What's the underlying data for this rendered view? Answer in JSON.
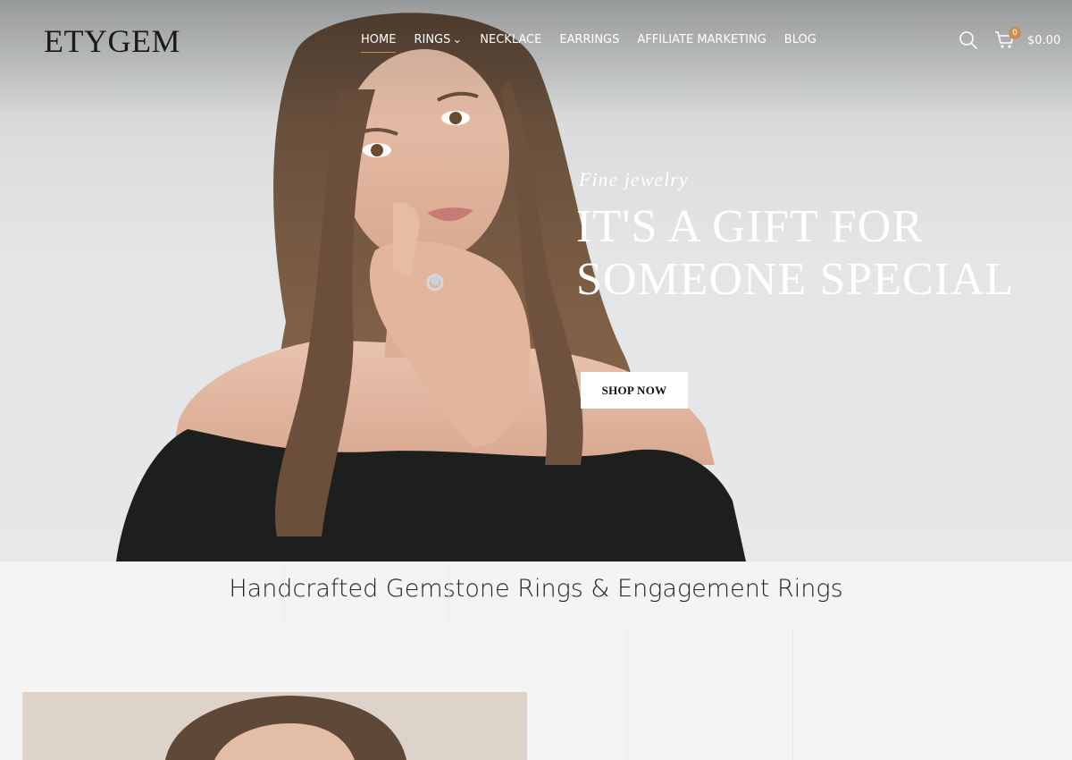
{
  "header": {
    "logo": "ETYGEM",
    "nav": [
      {
        "label": "HOME",
        "active": true
      },
      {
        "label": "RINGS",
        "has_dropdown": true
      },
      {
        "label": "NECKLACE"
      },
      {
        "label": "EARRINGS"
      },
      {
        "label": "AFFILIATE MARKETING"
      },
      {
        "label": "BLOG"
      }
    ],
    "cart": {
      "count": "0",
      "total": "$0.00"
    },
    "icons": {
      "search": "search-icon",
      "cart": "cart-icon"
    }
  },
  "hero": {
    "kicker": "Fine jewelry",
    "title_line1": "IT'S A GIFT FOR",
    "title_line2": "SOMEONE SPECIAL",
    "cta": "SHOP NOW"
  },
  "section": {
    "title": "Handcrafted Gemstone Rings & Engagement Rings"
  },
  "colors": {
    "accent": "#c98d52",
    "text_dark": "#222222",
    "nav_text": "#ffffff",
    "page_bg": "#f4f4f4"
  }
}
